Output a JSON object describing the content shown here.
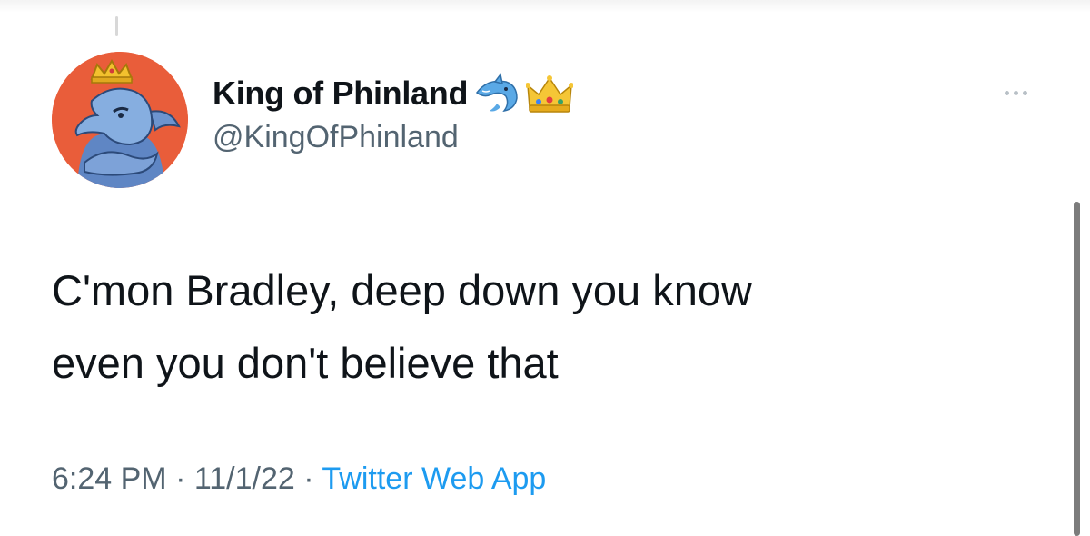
{
  "tweet": {
    "author": {
      "display_name": "King of Phinland",
      "handle": "@KingOfPhinland",
      "name_emojis": [
        "dolphin-icon",
        "crown-icon"
      ]
    },
    "text_lines": [
      "C'mon Bradley, deep down you know",
      "even you don't believe that"
    ],
    "meta": {
      "time": "6:24 PM",
      "separator": "·",
      "date": "11/1/22",
      "source": "Twitter Web App"
    },
    "more_icon": "more-horizontal-icon"
  },
  "colors": {
    "text_primary": "#0f1419",
    "text_secondary": "#536471",
    "link": "#1d9bf0",
    "avatar_bg": "#e95d3a"
  }
}
